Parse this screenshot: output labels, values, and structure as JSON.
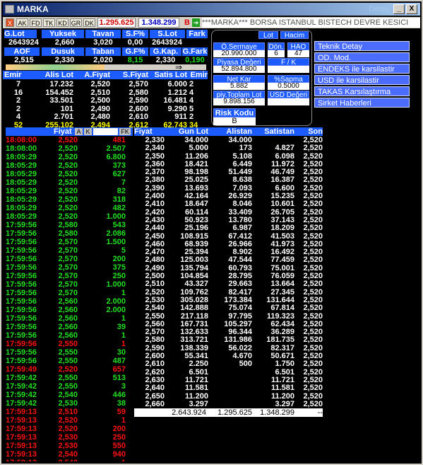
{
  "window": {
    "title": "MARKA",
    "watermark": "Detay",
    "btn_min": "_",
    "btn_close": "X"
  },
  "toolbar": {
    "tabs": [
      "X",
      "AK",
      "FD",
      "TK",
      "KD",
      "GR",
      "DK"
    ],
    "value1": "1.295.625",
    "value2": "1.348.299",
    "b_label": "B",
    "marquee": "***MARKA*** BORSA ISTANBUL BISTECH DEVRE KESICI"
  },
  "summary": {
    "row1_headers": [
      "G.Lot",
      "Yuksek",
      "Tavan",
      "S.F%",
      "S.Lot",
      "Fark"
    ],
    "row1_values": [
      "2643924",
      "2,660",
      "3,020",
      "0,00",
      "2643924",
      ""
    ],
    "row2_headers": [
      "AOF",
      "Dusuk",
      "Taban",
      "G.F%",
      "G.Kap.",
      "G.Fark"
    ],
    "row2_values": [
      "2,515",
      "2,330",
      "2,020",
      "8,15",
      "2,330",
      "0,190"
    ],
    "arrow": "⇒"
  },
  "orders": {
    "headers": [
      "Emir",
      "Alis Lot",
      "A.Fiyat",
      "S.Fiyat",
      "Satis Lot",
      "Emir"
    ],
    "rows": [
      [
        "7",
        "17.232",
        "2,520",
        "2,570",
        "6.000",
        "2"
      ],
      [
        "16",
        "154.452",
        "2,510",
        "2,580",
        "1.212",
        "4"
      ],
      [
        "2",
        "33.501",
        "2,500",
        "2,590",
        "16.481",
        "4"
      ],
      [
        "2",
        "101",
        "2,490",
        "2,600",
        "9.290",
        "5"
      ],
      [
        "4",
        "2.701",
        "2,480",
        "2,610",
        "911",
        "2"
      ],
      [
        "52",
        "255.102",
        "2,494",
        "2,612",
        "62.743",
        "34"
      ]
    ]
  },
  "stats": {
    "lot": "Lot",
    "hacim": "Hacim",
    "o_sermaye_label": "Ö.Sermaye",
    "o_sermaye": "20.990.000",
    "don_label": "Dön.",
    "don": "6",
    "hao_label": "HAO",
    "hao": "47",
    "piyasa_label": "Piyasa Değeri",
    "piyasa": "52.894.800",
    "fk_label": "F / K",
    "fk": "",
    "netkar_label": "Net Kar",
    "netkar": "5.882",
    "sapma_label": "%Sapma",
    "sapma": "0.5000",
    "piytop_label": "piy.Toplam Lot",
    "piytop": "9.898.156",
    "usd_label": "USD Değeri",
    "usd": "",
    "risk_label": "Risk Kodu",
    "risk": "B"
  },
  "menu": [
    "Teknik Detay",
    "OD. Mod.",
    "ENDEKS ile karsilastir",
    "USD ile karsilastir",
    "TAKAS Karsılaştırma",
    "Sirket Haberleri"
  ],
  "trades": {
    "header": "Fiyat",
    "btn_a": "A",
    "btn_k": "K",
    "btn_fk": "FK",
    "rows": [
      [
        "18:08:00",
        "2,520",
        "481",
        "r"
      ],
      [
        "18:08:00",
        "2,520",
        "2.507",
        "g"
      ],
      [
        "18:05:29",
        "2,520",
        "6.800",
        "g"
      ],
      [
        "18:05:29",
        "2,520",
        "373",
        "g"
      ],
      [
        "18:05:29",
        "2,520",
        "627",
        "g"
      ],
      [
        "18:05:29",
        "2,520",
        "7",
        "g"
      ],
      [
        "18:05:29",
        "2,520",
        "82",
        "g"
      ],
      [
        "18:05:29",
        "2,520",
        "318",
        "g"
      ],
      [
        "18:05:29",
        "2,520",
        "482",
        "g"
      ],
      [
        "18:05:29",
        "2,520",
        "1.000",
        "g"
      ],
      [
        "17:59:56",
        "2,580",
        "543",
        "g"
      ],
      [
        "17:59:56",
        "2,580",
        "2.086",
        "g"
      ],
      [
        "17:59:56",
        "2,570",
        "1.500",
        "g"
      ],
      [
        "17:59:56",
        "2,570",
        "5",
        "g"
      ],
      [
        "17:59:56",
        "2,570",
        "200",
        "g"
      ],
      [
        "17:59:56",
        "2,570",
        "375",
        "g"
      ],
      [
        "17:59:56",
        "2,570",
        "250",
        "g"
      ],
      [
        "17:59:56",
        "2,570",
        "1.000",
        "g"
      ],
      [
        "17:59:56",
        "2,570",
        "1",
        "g"
      ],
      [
        "17:59:56",
        "2,560",
        "2.000",
        "g"
      ],
      [
        "17:59:56",
        "2,560",
        "2.000",
        "g"
      ],
      [
        "17:59:56",
        "2,560",
        "1",
        "g"
      ],
      [
        "17:59:56",
        "2,560",
        "39",
        "g"
      ],
      [
        "17:59:56",
        "2,560",
        "1",
        "g"
      ],
      [
        "17:59:56",
        "2,550",
        "1",
        "r"
      ],
      [
        "17:59:56",
        "2,550",
        "30",
        "g"
      ],
      [
        "17:59:56",
        "2,550",
        "487",
        "g"
      ],
      [
        "17:59:49",
        "2,520",
        "657",
        "r"
      ],
      [
        "17:59:42",
        "2,550",
        "513",
        "g"
      ],
      [
        "17:59:42",
        "2,550",
        "3",
        "g"
      ],
      [
        "17:59:42",
        "2,540",
        "446",
        "g"
      ],
      [
        "17:59:42",
        "2,530",
        "38",
        "g"
      ],
      [
        "17:59:13",
        "2,510",
        "59",
        "r"
      ],
      [
        "17:59:13",
        "2,520",
        "1",
        "r"
      ],
      [
        "17:59:13",
        "2,520",
        "200",
        "r"
      ],
      [
        "17:59:13",
        "2,530",
        "250",
        "r"
      ],
      [
        "17:59:13",
        "2,530",
        "550",
        "r"
      ],
      [
        "17:59:13",
        "2,540",
        "940",
        "r"
      ],
      [
        "17:59:13",
        "2,540",
        "1",
        "r"
      ]
    ]
  },
  "depth": {
    "headers": [
      "Fiyat",
      "Gun Lot",
      "Alistan",
      "Satistan",
      "Son"
    ],
    "rows": [
      [
        "2,330",
        "34.000",
        "34.000",
        "",
        "2,520"
      ],
      [
        "2,340",
        "5.000",
        "173",
        "4.827",
        "2,520"
      ],
      [
        "2,350",
        "11.206",
        "5.108",
        "6.098",
        "2,520"
      ],
      [
        "2,360",
        "18.421",
        "6.449",
        "11.972",
        "2,520"
      ],
      [
        "2,370",
        "98.198",
        "51.449",
        "46.749",
        "2,520"
      ],
      [
        "2,380",
        "25.025",
        "8.638",
        "16.387",
        "2,520"
      ],
      [
        "2,390",
        "13.693",
        "7.093",
        "6.600",
        "2,520"
      ],
      [
        "2,400",
        "42.164",
        "26.929",
        "15.235",
        "2,520"
      ],
      [
        "2,410",
        "18.647",
        "8.046",
        "10.601",
        "2,520"
      ],
      [
        "2,420",
        "60.114",
        "33.409",
        "26.705",
        "2,520"
      ],
      [
        "2,430",
        "50.923",
        "13.780",
        "37.143",
        "2,520"
      ],
      [
        "2,440",
        "25.196",
        "6.987",
        "18.209",
        "2,520"
      ],
      [
        "2,450",
        "108.915",
        "67.412",
        "41.503",
        "2,520"
      ],
      [
        "2,460",
        "68.939",
        "26.966",
        "41.973",
        "2,520"
      ],
      [
        "2,470",
        "25.394",
        "8.902",
        "16.492",
        "2,520"
      ],
      [
        "2,480",
        "125.003",
        "47.544",
        "77.459",
        "2,520"
      ],
      [
        "2,490",
        "135.794",
        "60.793",
        "75.001",
        "2,520"
      ],
      [
        "2,500",
        "104.854",
        "28.795",
        "76.059",
        "2,520"
      ],
      [
        "2,510",
        "43.327",
        "29.663",
        "13.664",
        "2,520"
      ],
      [
        "2,520",
        "109.762",
        "82.417",
        "27.345",
        "2,520"
      ],
      [
        "2,530",
        "305.028",
        "173.384",
        "131.644",
        "2,520"
      ],
      [
        "2,540",
        "142.888",
        "75.074",
        "67.814",
        "2,520"
      ],
      [
        "2,550",
        "217.118",
        "97.795",
        "119.323",
        "2,520"
      ],
      [
        "2,560",
        "167.731",
        "105.297",
        "62.434",
        "2,520"
      ],
      [
        "2,570",
        "132.633",
        "96.344",
        "36.289",
        "2,520"
      ],
      [
        "2,580",
        "313.721",
        "131.986",
        "181.735",
        "2,520"
      ],
      [
        "2,590",
        "138.339",
        "56.022",
        "82.317",
        "2,520"
      ],
      [
        "2,600",
        "55.341",
        "4.670",
        "50.671",
        "2,520"
      ],
      [
        "2,610",
        "2.250",
        "500",
        "1.750",
        "2,520"
      ],
      [
        "2,620",
        "6.501",
        "",
        "6.501",
        "2,520"
      ],
      [
        "2,630",
        "11.721",
        "",
        "11.721",
        "2,520"
      ],
      [
        "2,640",
        "11.581",
        "",
        "11.581",
        "2,520"
      ],
      [
        "2,650",
        "11.200",
        "",
        "11.200",
        "2,520"
      ],
      [
        "2,660",
        "3.297",
        "",
        "3.297",
        "2,520"
      ],
      [
        "",
        "",
        "",
        "",
        "2,520"
      ]
    ],
    "totals": [
      "2.643.924",
      "1.295.625",
      "1.348.299",
      "--"
    ]
  }
}
